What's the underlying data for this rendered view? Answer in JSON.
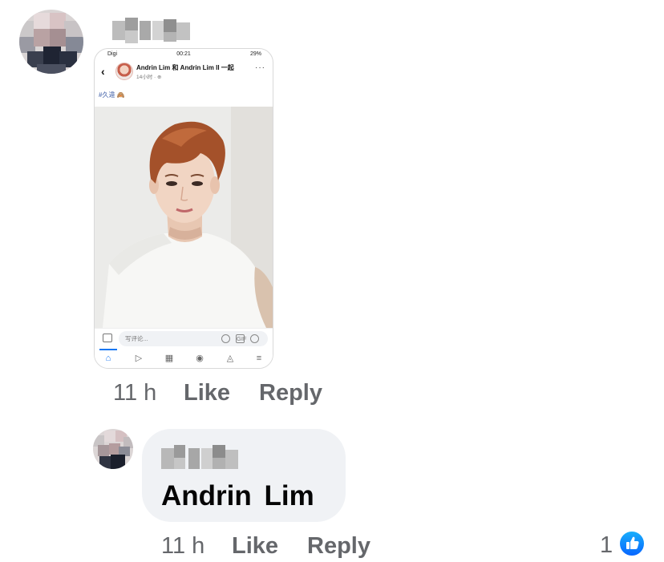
{
  "comment": {
    "attachment": {
      "status_bar": {
        "carrier": "Digi",
        "time": "00:21",
        "battery": "29%"
      },
      "poster_line": "Andrin  Lim 和 Andrin Lim II 一起",
      "post_time": "14小时 · ⊕",
      "hashtag": "#久違 🙈",
      "comment_placeholder": "写评论...",
      "gif_label": "GIF"
    },
    "time": "11 h",
    "like_label": "Like",
    "reply_label": "Reply"
  },
  "reply": {
    "text": "Andrin  Lim",
    "time": "11 h",
    "like_label": "Like",
    "reply_label": "Reply",
    "reaction_count": "1"
  },
  "icons": {
    "back": "chevron-left-icon",
    "more": "more-dots-icon",
    "camera": "camera-icon",
    "like_reaction": "thumbs-up-icon"
  },
  "colors": {
    "accent": "#1877f2",
    "bubble": "#f0f2f5",
    "meta": "#65676b"
  }
}
